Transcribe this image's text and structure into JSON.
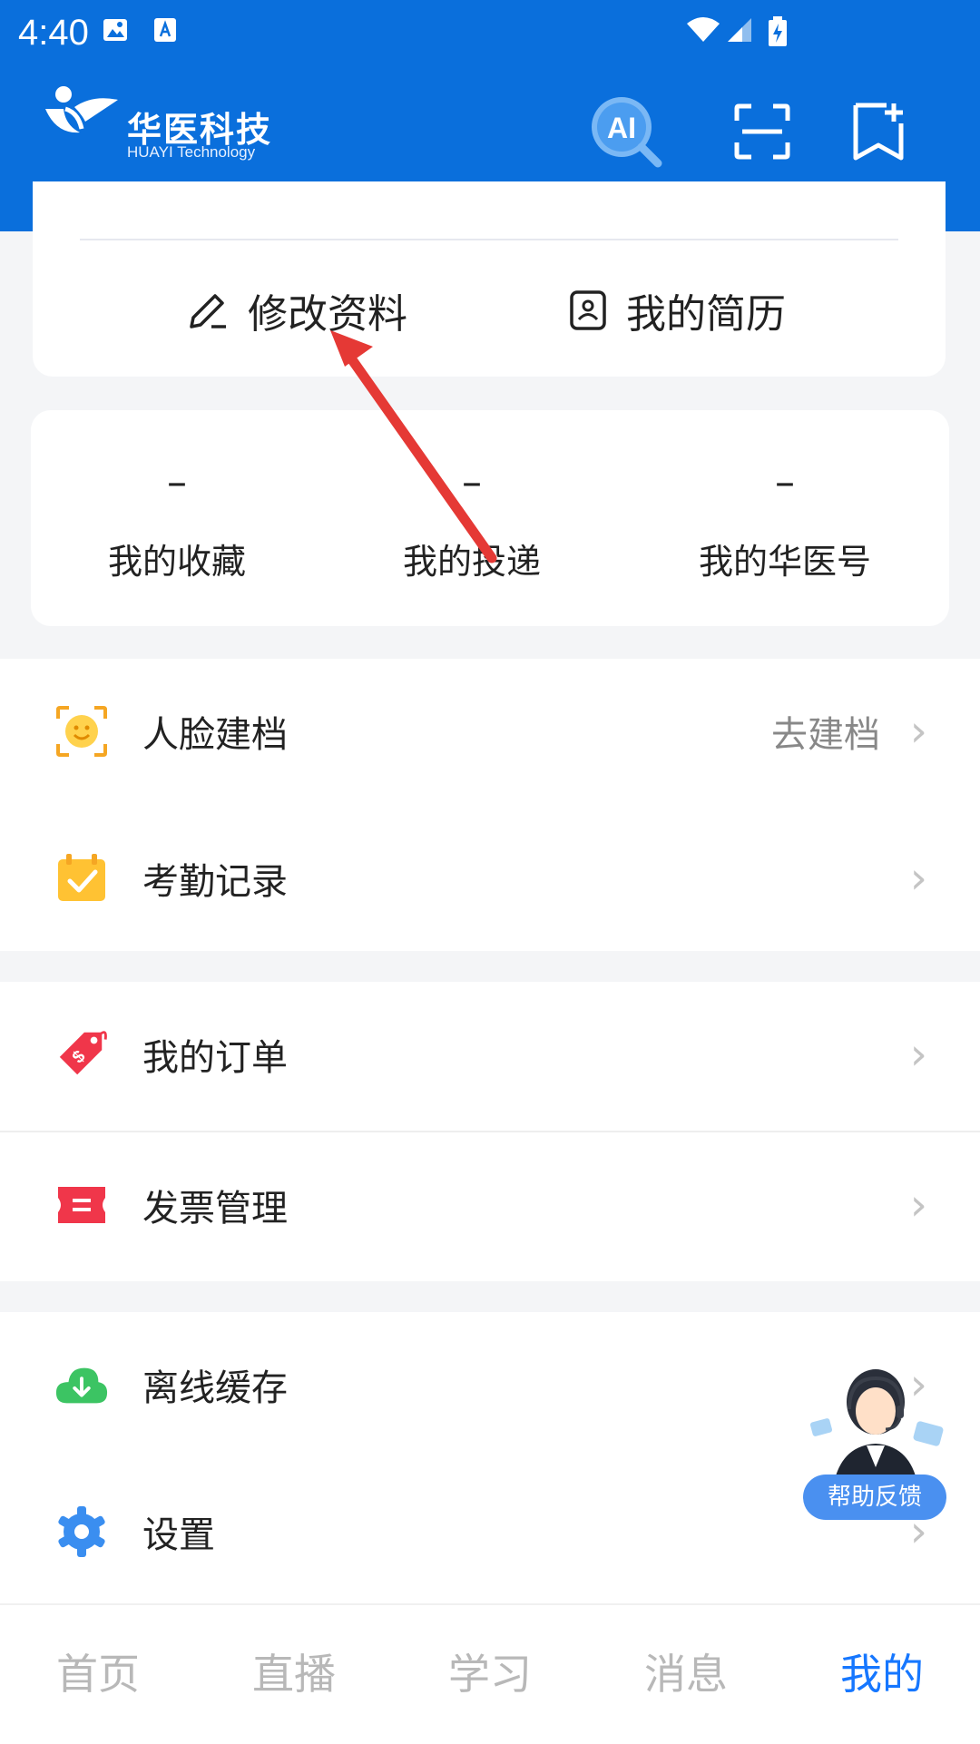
{
  "status_bar": {
    "time": "4:40"
  },
  "header": {
    "logo_cn": "华医科技",
    "logo_en": "HUAYI Technology",
    "ai_label": "AI"
  },
  "profile_actions": {
    "edit": "修改资料",
    "resume": "我的简历"
  },
  "stats": [
    {
      "value": "–",
      "label": "我的收藏"
    },
    {
      "value": "–",
      "label": "我的投递"
    },
    {
      "value": "–",
      "label": "我的华医号"
    }
  ],
  "menu": {
    "face": {
      "title": "人脸建档",
      "extra": "去建档"
    },
    "attendance": {
      "title": "考勤记录"
    },
    "orders": {
      "title": "我的订单"
    },
    "invoice": {
      "title": "发票管理"
    },
    "offline": {
      "title": "离线缓存"
    },
    "settings": {
      "title": "设置"
    }
  },
  "help": {
    "label": "帮助反馈"
  },
  "bottom_nav": [
    {
      "label": "首页",
      "active": false
    },
    {
      "label": "直播",
      "active": false
    },
    {
      "label": "学习",
      "active": false
    },
    {
      "label": "消息",
      "active": false
    },
    {
      "label": "我的",
      "active": true
    }
  ],
  "colors": {
    "brand": "#0a6fdc",
    "accent": "#1677ff",
    "annotation_arrow": "#e53935"
  }
}
